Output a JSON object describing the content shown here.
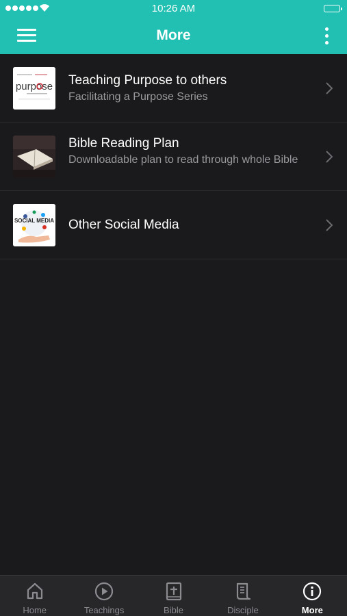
{
  "status_bar": {
    "time": "10:26 AM"
  },
  "header": {
    "title": "More"
  },
  "items": [
    {
      "title": "Teaching Purpose to others",
      "subtitle": "Facilitating a Purpose Series",
      "thumb_text": "purpose"
    },
    {
      "title": "Bible Reading Plan",
      "subtitle": "Downloadable plan to read through whole Bible"
    },
    {
      "title": "Other Social Media",
      "subtitle": "",
      "thumb_text": "SOCIAL MEDIA"
    }
  ],
  "tabs": [
    {
      "label": "Home",
      "icon": "home-icon",
      "active": false
    },
    {
      "label": "Teachings",
      "icon": "play-circle-icon",
      "active": false
    },
    {
      "label": "Bible",
      "icon": "bible-icon",
      "active": false
    },
    {
      "label": "Disciple",
      "icon": "scroll-icon",
      "active": false
    },
    {
      "label": "More",
      "icon": "info-icon",
      "active": true
    }
  ],
  "colors": {
    "accent": "#22c0b2",
    "background": "#1a1a1c",
    "tabbar": "#27272a"
  }
}
